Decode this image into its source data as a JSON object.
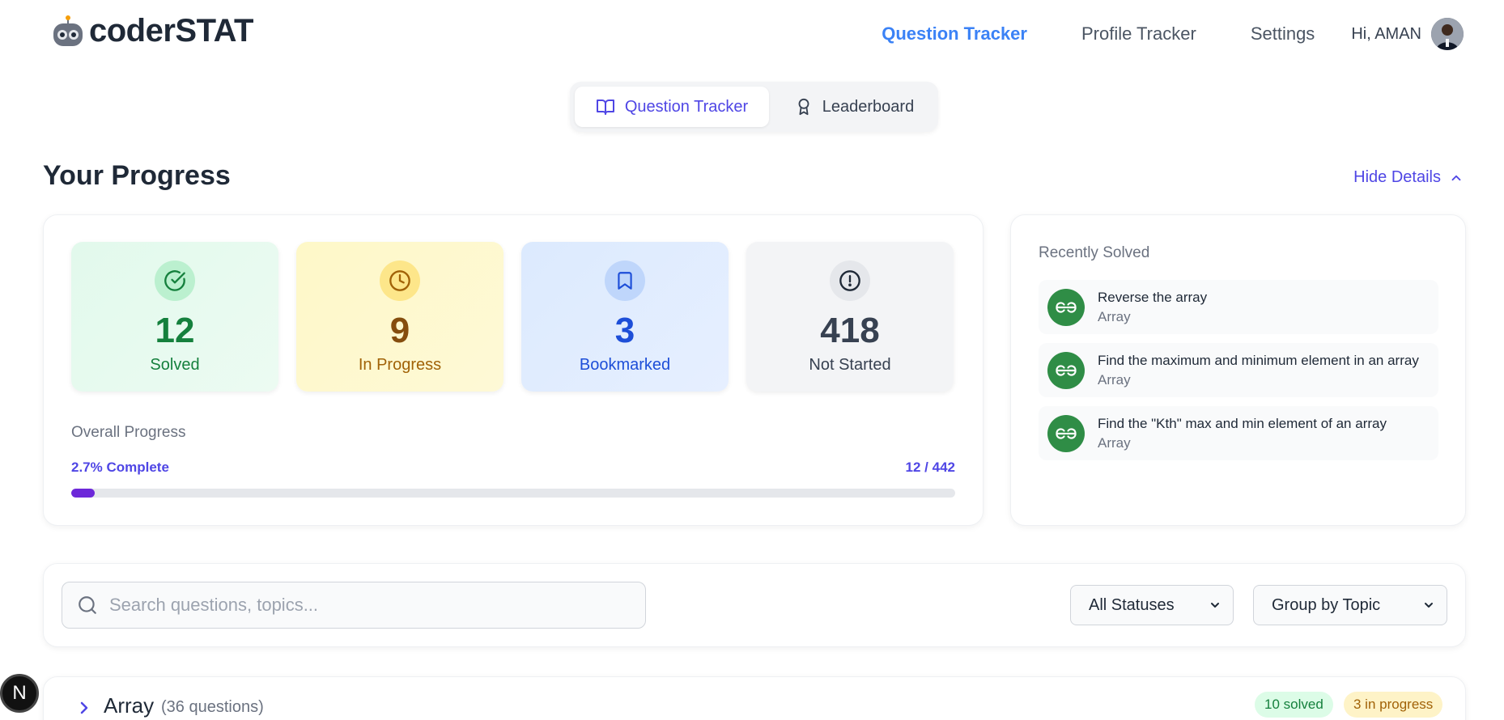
{
  "app": {
    "logo_text": "coderSTAT"
  },
  "nav": {
    "links": [
      "Question Tracker",
      "Profile Tracker",
      "Settings"
    ],
    "greeting": "Hi, AMAN"
  },
  "tabs": [
    {
      "label": "Question Tracker",
      "icon": "book-open-icon",
      "active": true
    },
    {
      "label": "Leaderboard",
      "icon": "award-icon",
      "active": false
    }
  ],
  "progress": {
    "title": "Your Progress",
    "toggle_label": "Hide Details",
    "stats": [
      {
        "value": "12",
        "label": "Solved",
        "icon": "check-circle-icon",
        "color": "#15803d"
      },
      {
        "value": "9",
        "label": "In Progress",
        "icon": "clock-icon",
        "color": "#a16207"
      },
      {
        "value": "3",
        "label": "Bookmarked",
        "icon": "bookmark-icon",
        "color": "#1d4ed8"
      },
      {
        "value": "418",
        "label": "Not Started",
        "icon": "alert-circle-icon",
        "color": "#374151"
      }
    ],
    "overall_label": "Overall Progress",
    "percent_text": "2.7% Complete",
    "count_text": "12 / 442",
    "fraction": 0.027
  },
  "recent": {
    "title": "Recently Solved",
    "items": [
      {
        "name": "Reverse the array",
        "topic": "Array"
      },
      {
        "name": "Find the maximum and minimum element in an array",
        "topic": "Array"
      },
      {
        "name": "Find the \"Kth\" max and min element of an array",
        "topic": "Array"
      }
    ]
  },
  "filters": {
    "search_placeholder": "Search questions, topics...",
    "status_value": "All Statuses",
    "group_value": "Group by Topic"
  },
  "topics": [
    {
      "name": "Array",
      "count": "(36 questions)",
      "solved_badge": "10 solved",
      "progress_badge": "3 in progress"
    }
  ],
  "next_indicator": "N"
}
